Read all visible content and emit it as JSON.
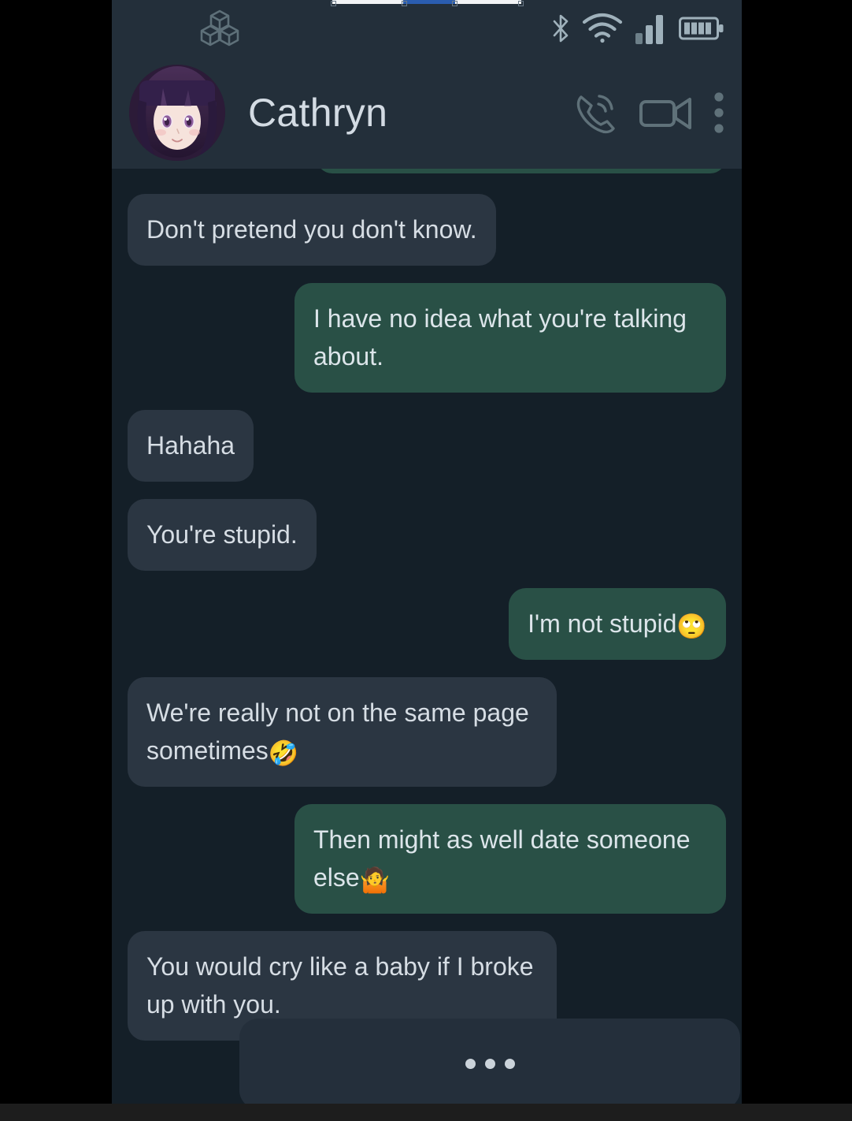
{
  "device": {
    "status_bar": {
      "app_logo_icon": "cubes-logo-icon",
      "icons": [
        "bluetooth-icon",
        "wifi-icon",
        "cellular-signal-icon",
        "battery-icon"
      ]
    },
    "top_seek_bar": {
      "name": "screen-record-seek-bar",
      "progress_percent": 38
    },
    "bottom_nav_strip": ""
  },
  "header": {
    "avatar_alt": "Cathryn avatar",
    "contact_name": "Cathryn",
    "actions": [
      {
        "name": "voice-call-button",
        "icon": "phone-call-icon"
      },
      {
        "name": "video-call-button",
        "icon": "video-camera-icon"
      },
      {
        "name": "more-options-button",
        "icon": "more-vertical-icon"
      }
    ]
  },
  "conversation": {
    "messages": [
      {
        "id": 0,
        "direction": "outgoing",
        "text": "",
        "clipped": true
      },
      {
        "id": 1,
        "direction": "incoming",
        "text": "Don't pretend you don't know.",
        "emoji": ""
      },
      {
        "id": 2,
        "direction": "outgoing",
        "text": "I have no idea what you're talking about.",
        "emoji": ""
      },
      {
        "id": 3,
        "direction": "incoming",
        "text": "Hahaha",
        "emoji": ""
      },
      {
        "id": 4,
        "direction": "incoming",
        "text": "You're stupid.",
        "emoji": ""
      },
      {
        "id": 5,
        "direction": "outgoing",
        "text": "I'm not stupid",
        "emoji": "🙄"
      },
      {
        "id": 6,
        "direction": "incoming",
        "text": "We're really not on the same page sometimes",
        "emoji": "🤣"
      },
      {
        "id": 7,
        "direction": "outgoing",
        "text": "Then might as well date someone else",
        "emoji": "🤷"
      },
      {
        "id": 8,
        "direction": "incoming",
        "text": "You would cry like a baby if I broke up with you.",
        "emoji": ""
      }
    ],
    "typing_indicator": {
      "name": "typing-indicator",
      "dots": 3
    }
  },
  "overlay": {
    "close_button": {
      "name": "close-overlay-button",
      "icon": "close-x-icon"
    }
  },
  "colors": {
    "page_background": "#000000",
    "chat_background": "#141f28",
    "header_background": "#232f3a",
    "incoming_bubble": "#2b3642",
    "outgoing_bubble": "#295046",
    "text_primary": "#d6dde4",
    "contact_name": "#d3dbe3",
    "icon_tint": "#5f7179",
    "fab_background": "#b9c0c6",
    "seek_fill": "#2a5db0"
  }
}
